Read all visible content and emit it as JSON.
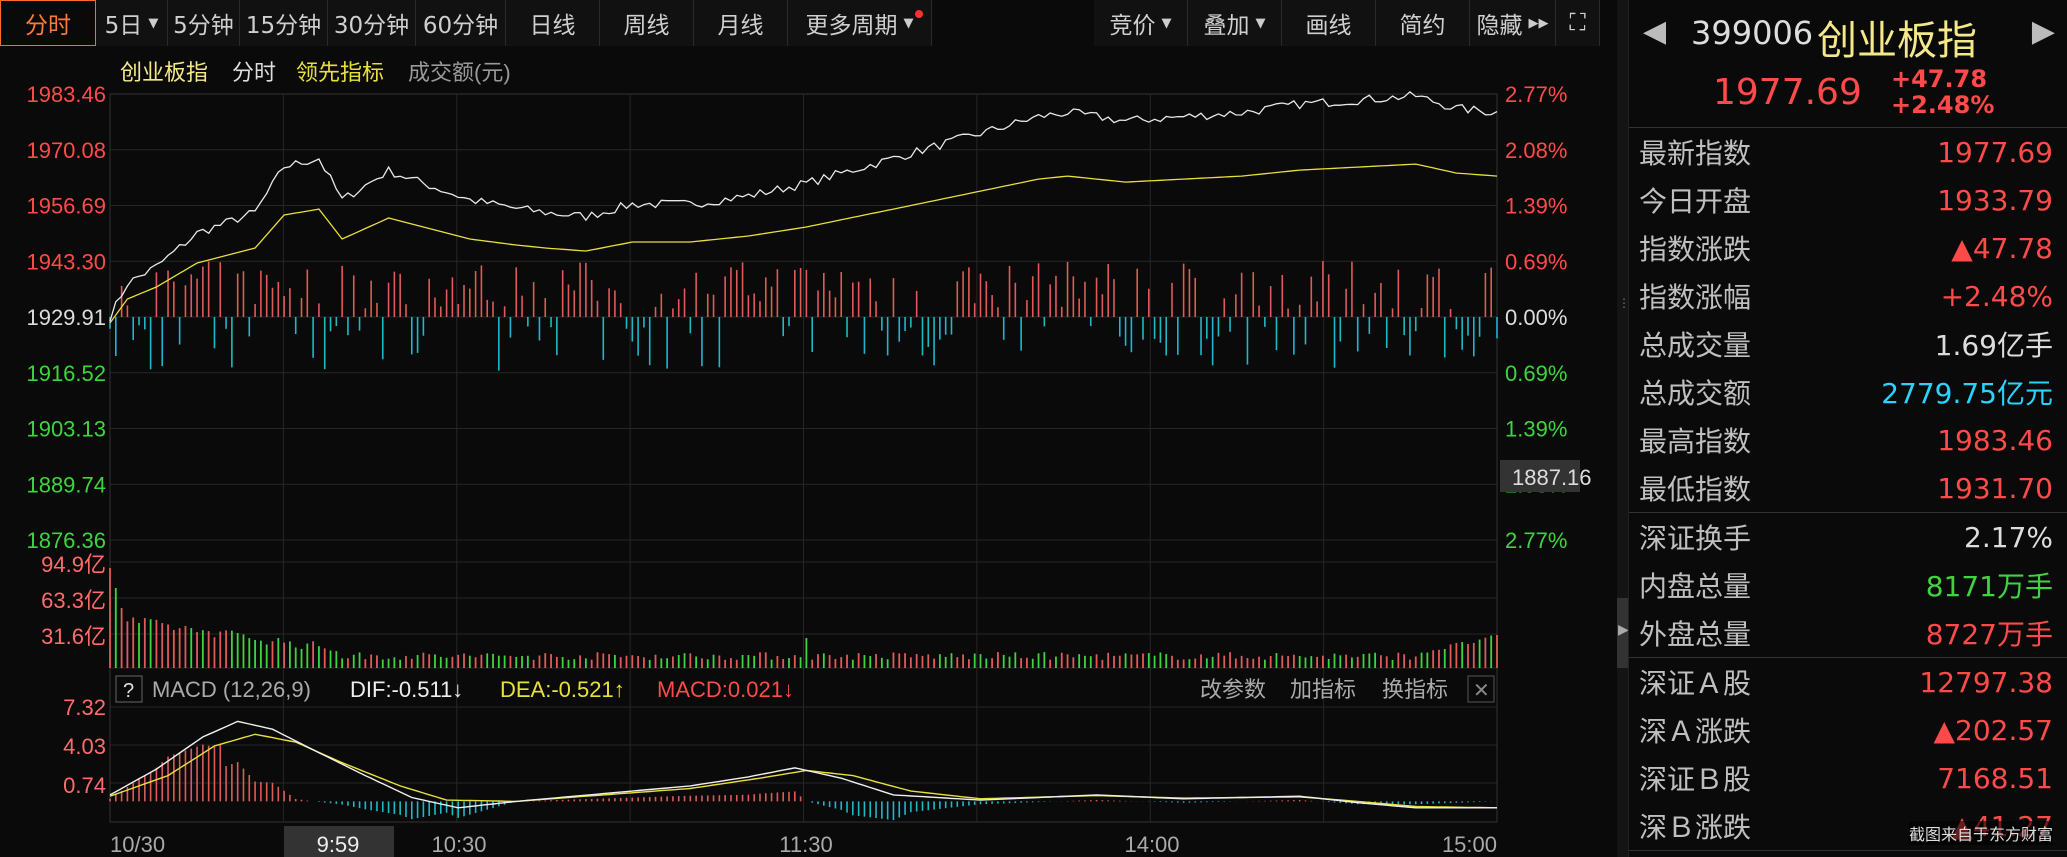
{
  "toolbar": {
    "periods": [
      "分时",
      "5日",
      "5分钟",
      "15分钟",
      "30分钟",
      "60分钟",
      "日线",
      "周线",
      "月线",
      "更多周期"
    ],
    "right": [
      "竞价",
      "叠加",
      "画线",
      "简约",
      "隐藏"
    ],
    "accent": "#ff6a2a"
  },
  "legend": {
    "name": "创业板指",
    "mode": "分时",
    "leading": "领先指标",
    "volume": "成交额(元)"
  },
  "price_axis": {
    "left": [
      "1983.46",
      "1970.08",
      "1956.69",
      "1943.30",
      "1929.91",
      "1916.52",
      "1903.13",
      "1889.74",
      "1876.36"
    ],
    "right": [
      "2.77%",
      "2.08%",
      "1.39%",
      "0.69%",
      "0.00%",
      "0.69%",
      "1.39%",
      "2.08%",
      "2.77%"
    ],
    "crosshair_value": "1887.16"
  },
  "volume_axis": [
    "94.9亿",
    "63.3亿",
    "31.6亿"
  ],
  "macd": {
    "help": "?",
    "title": "MACD (12,26,9)",
    "dif": "DIF:-0.511↓",
    "dea": "DEA:-0.521↑",
    "macd": "MACD:0.021↓",
    "axis": [
      "7.32",
      "4.03",
      "0.74"
    ],
    "actions": [
      "改参数",
      "加指标",
      "换指标"
    ]
  },
  "time_axis": [
    "10/30",
    "9:59",
    "10:30",
    "11:30",
    "14:00",
    "15:00"
  ],
  "quote": {
    "code": "399006",
    "name": "创业板指",
    "price": "1977.69",
    "change": "+47.78",
    "change_pct": "+2.48%",
    "groups": [
      [
        {
          "k": "最新指数",
          "v": "1977.69",
          "c": "red"
        },
        {
          "k": "今日开盘",
          "v": "1933.79",
          "c": "red"
        },
        {
          "k": "指数涨跌",
          "v": "▲47.78",
          "c": "red"
        },
        {
          "k": "指数涨幅",
          "v": "+2.48%",
          "c": "red"
        },
        {
          "k": "总成交量",
          "v": "1.69亿手",
          "c": "white"
        },
        {
          "k": "总成交额",
          "v": "2779.75亿元",
          "c": "cur"
        },
        {
          "k": "最高指数",
          "v": "1983.46",
          "c": "red"
        },
        {
          "k": "最低指数",
          "v": "1931.70",
          "c": "red"
        }
      ],
      [
        {
          "k": "深证换手",
          "v": "2.17%",
          "c": "white"
        },
        {
          "k": "内盘总量",
          "v": "8171万手",
          "c": "green"
        },
        {
          "k": "外盘总量",
          "v": "8727万手",
          "c": "red"
        }
      ],
      [
        {
          "k": "深证Ａ股",
          "v": "12797.38",
          "c": "red"
        },
        {
          "k": "深Ａ涨跌",
          "v": "▲202.57",
          "c": "red"
        },
        {
          "k": "深证Ｂ股",
          "v": "7168.51",
          "c": "red"
        },
        {
          "k": "深Ｂ涨跌",
          "v": "▲41.27",
          "c": "red"
        }
      ]
    ]
  },
  "watermark": "截图来自于东方财富",
  "colors": {
    "up": "#ff4a4a",
    "down": "#3fd43f",
    "price_line": "#e8e8e8",
    "avg_line": "#e8e03a",
    "bar_up": "#e05a5a",
    "bar_down": "#1fb8c8"
  }
}
